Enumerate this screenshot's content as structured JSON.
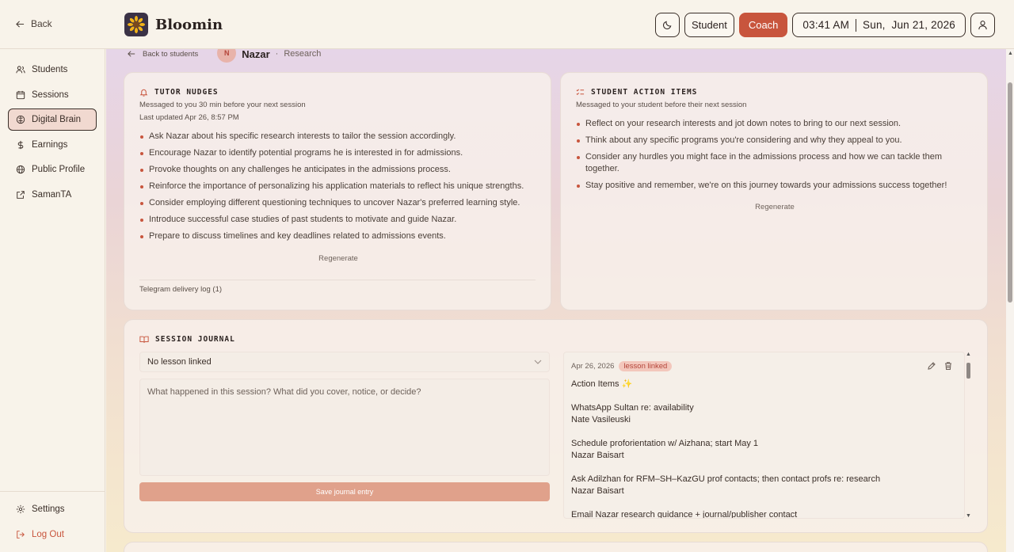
{
  "topbar": {
    "back_label": "Back",
    "brand": "Bloomin",
    "theme_icon": "moon-icon",
    "role_student": "Student",
    "role_coach": "Coach",
    "time": "03:41 AM",
    "date": "Sun,  Jun 21, 2026",
    "profile_icon": "user-icon"
  },
  "sidebar": {
    "items": [
      {
        "label": "Students",
        "icon": "users-icon"
      },
      {
        "label": "Sessions",
        "icon": "calendar-icon"
      },
      {
        "label": "Digital Brain",
        "icon": "brain-icon",
        "active": true
      },
      {
        "label": "Earnings",
        "icon": "dollar-icon"
      },
      {
        "label": "Public Profile",
        "icon": "globe-icon"
      },
      {
        "label": "SamanTA",
        "icon": "external-link-icon"
      }
    ],
    "settings": "Settings",
    "logout": "Log Out"
  },
  "breadcrumb": {
    "back": "Back to students",
    "initial": "N",
    "name": "Nazar",
    "separator": "·",
    "section": "Research"
  },
  "tutor_nudges": {
    "title": "TUTOR NUDGES",
    "subtitle": "Messaged to you 30 min before your next session",
    "updated": "Last updated Apr 26, 8:57 PM",
    "items": [
      "Ask Nazar about his specific research interests to tailor the session accordingly.",
      "Encourage Nazar to identify potential programs he is interested in for admissions.",
      "Provoke thoughts on any challenges he anticipates in the admissions process.",
      "Reinforce the importance of personalizing his application materials to reflect his unique strengths.",
      "Consider employing different questioning techniques to uncover Nazar's preferred learning style.",
      "Introduce successful case studies of past students to motivate and guide Nazar.",
      "Prepare to discuss timelines and key deadlines related to admissions events."
    ],
    "regenerate": "Regenerate",
    "log": "Telegram delivery log (1)"
  },
  "student_actions": {
    "title": "STUDENT ACTION ITEMS",
    "subtitle": "Messaged to your student before their next session",
    "items": [
      "Reflect on your research interests and jot down notes to bring to our next session.",
      "Think about any specific programs you're considering and why they appeal to you.",
      "Consider any hurdles you might face in the admissions process and how we can tackle them together.",
      "Stay positive and remember, we're on this journey towards your admissions success together!"
    ],
    "regenerate": "Regenerate"
  },
  "journal": {
    "title": "SESSION JOURNAL",
    "lesson_select": "No lesson linked",
    "placeholder": "What happened in this session? What did you cover, notice, or decide?",
    "save": "Save journal entry",
    "entry": {
      "date": "Apr 26, 2026",
      "tag": "lesson linked",
      "heading": "Action Items ✨",
      "lines": [
        [
          "WhatsApp Sultan re: availability",
          "Nate Vasileuski"
        ],
        [
          "Schedule proforientation w/ Aizhana; start May 1",
          "Nazar Baisart"
        ],
        [
          "Ask Adilzhan for RFM–SH–KazGU prof contacts; then contact profs re: research",
          "Nazar Baisart"
        ],
        [
          "Email Nazar research guidance + journal/publisher contact",
          ""
        ]
      ]
    }
  },
  "colors": {
    "accent": "#c8553d",
    "bullet": "#c8553d",
    "save_button": "#e0a18b"
  }
}
